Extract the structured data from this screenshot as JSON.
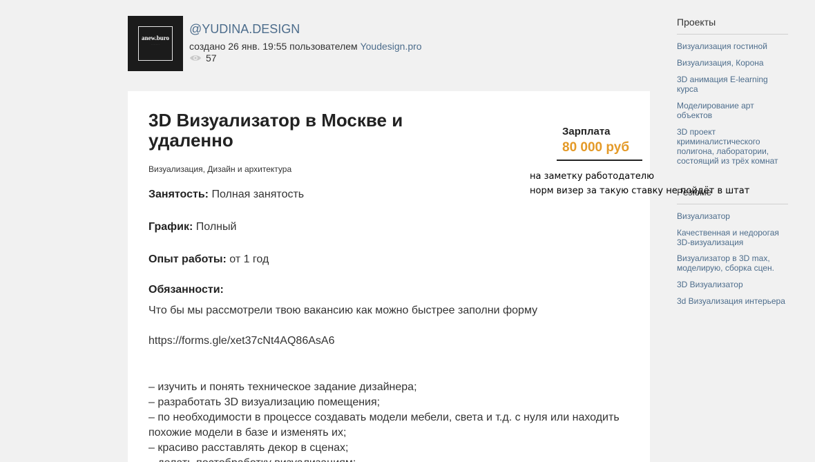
{
  "header": {
    "logo_text": "anew.buro",
    "author": "@YUDINA.DESIGN",
    "meta_prefix": "создано 26 янв. 19:55 пользователем",
    "meta_user": "Youdesign.pro",
    "views": "57",
    "eye_icon": "eye-icon"
  },
  "vacancy": {
    "title": "3D Визуализатор в Москве и удаленно",
    "category": "Визуализация, Дизайн и архитектура",
    "salary_label": "Зарплата",
    "salary_value": "80 000 руб",
    "employment_label": "Занятость:",
    "employment_value": "Полная занятость",
    "schedule_label": "График:",
    "schedule_value": "Полный",
    "experience_label": "Опыт работы:",
    "experience_value": "от 1 год",
    "duties_heading": "Обязанности:",
    "duties_intro": "Что бы мы рассмотрели твою вакансию как можно быстрее заполни форму",
    "form_link": "https://forms.gle/xet37cNt4AQ86AsA6",
    "duties": [
      "– изучить и понять техническое задание дизайнера;",
      "– разработать 3D визуализацию помещения;",
      "– по необходимости в процессе создавать модели мебели, света и т.д. с нуля или находить",
      "похожие модели в базе и изменять их;",
      "– красиво расставлять декор в сценах;",
      "– делать постобработку визуализациям;"
    ]
  },
  "annotation": {
    "line1": "на заметку работодателю",
    "line2": "норм визер за такую ставку не пойдёт в штат"
  },
  "sidebar": {
    "projects_heading": "Проекты",
    "projects": [
      "Визуализация гостиной",
      "Визуализация, Корона",
      "3D анимация E-learning курса",
      "Моделирование арт объектов",
      "3D проект криминалистического полигона, лаборатории, состоящий из трёх комнат"
    ],
    "resume_heading": "Резюме",
    "resumes": [
      "Визуализатор",
      "Качественная и недорогая 3D-визуализация",
      "Визуализатор в 3D max, моделирую, сборка сцен.",
      "3D Визуализатор",
      "3d Визуализация интерьера"
    ]
  },
  "colors": {
    "background": "#f1f1f1",
    "link": "#4d6d8c",
    "salary": "#e49a28"
  }
}
